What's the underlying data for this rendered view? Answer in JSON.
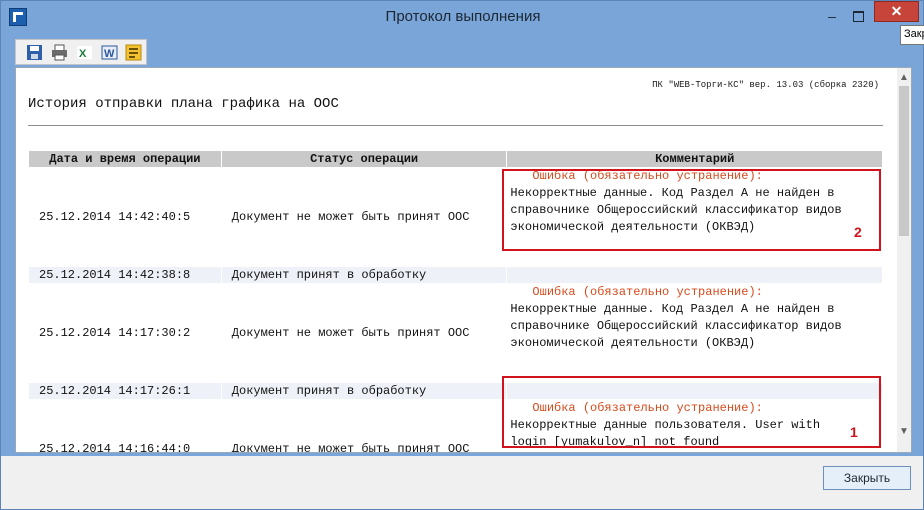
{
  "window": {
    "title": "Протокол выполнения",
    "minimize_glyph": "‒",
    "close_glyph": "✕",
    "tooltip": "Закр"
  },
  "toolbar": {
    "icons": [
      "save-icon",
      "print-icon",
      "excel-icon",
      "word-icon",
      "export-icon"
    ]
  },
  "report": {
    "version": "ПК \"WEB-Торги-КС\" вер. 13.03 (сборка 2320)",
    "title": "История отправки плана графика на ООС",
    "headers": [
      "Дата и время операции",
      "Статус операции",
      "Комментарий"
    ],
    "rows": [
      {
        "datetime": "25.12.2014 14:42:40:5",
        "status": "Документ не может быть принят ООС",
        "error": "Ошибка (обязательно устранение):",
        "comment": [
          "Некорректные данные. Код Раздел А не найден в",
          "справочнике Общероссийский классификатор видов",
          "экономической деятельности (ОКВЭД)"
        ]
      },
      {
        "datetime": "25.12.2014 14:42:38:8",
        "status": "Документ принят в обработку",
        "error": "",
        "comment": []
      },
      {
        "datetime": "25.12.2014 14:17:30:2",
        "status": "Документ не может быть принят ООС",
        "error": "Ошибка (обязательно устранение):",
        "comment": [
          "Некорректные данные. Код Раздел А не найден в",
          "справочнике Общероссийский классификатор видов",
          "экономической деятельности (ОКВЭД)"
        ]
      },
      {
        "datetime": "25.12.2014 14:17:26:1",
        "status": "Документ принят в обработку",
        "error": "",
        "comment": []
      },
      {
        "datetime": "25.12.2014 14:16:44:0",
        "status": "Документ не может быть принят ООС",
        "error": "Ошибка (обязательно устранение):",
        "comment": [
          "Некорректные данные пользователя. User with",
          "login [yumakulov_n] not found"
        ]
      }
    ],
    "annotations": [
      "2",
      "1"
    ]
  },
  "footer": {
    "close_label": "Закрыть"
  },
  "colors": {
    "error_text": "#d84a1b",
    "annotation": "#d1141b",
    "header_bg": "#c9c9c9"
  }
}
